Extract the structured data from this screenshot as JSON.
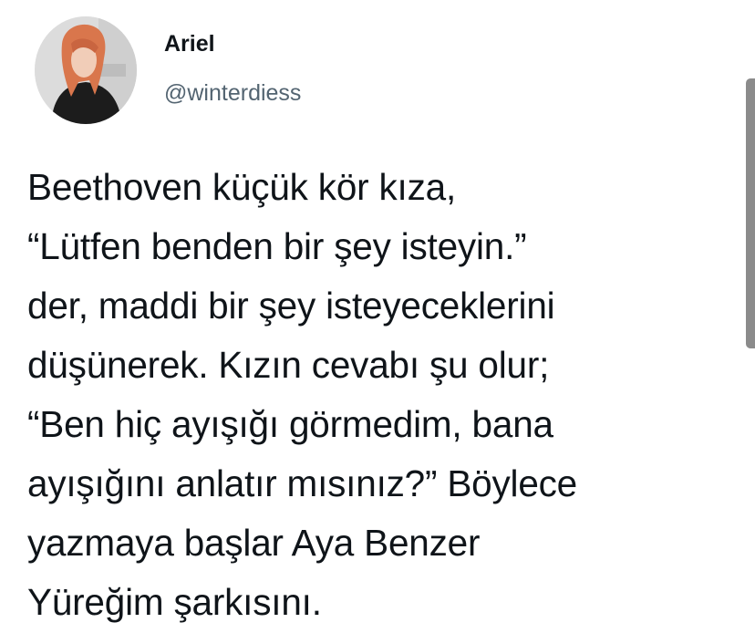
{
  "author": {
    "display_name": "Ariel",
    "handle": "@winterdiess"
  },
  "tweet": {
    "lines": [
      "Beethoven küçük kör kıza,",
      "“Lütfen benden bir şey isteyin.”",
      "der, maddi bir şey isteyeceklerini",
      "düşünerek. Kızın cevabı şu olur;",
      "“Ben hiç ayışığı görmedim, bana",
      "ayışığını anlatır mısınız?” Böylece",
      "yazmaya başlar Aya Benzer",
      "Yüreğim şarkısını."
    ]
  },
  "colors": {
    "text": "#0f1419",
    "handle": "#536471",
    "background": "#ffffff",
    "scrollbar": "#8b8b8b",
    "avatar_hair": "#d9764c"
  }
}
